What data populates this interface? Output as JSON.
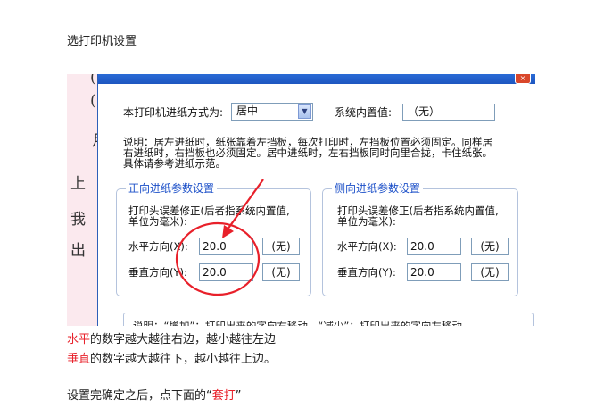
{
  "doc": {
    "heading": "选打印机设置",
    "line1": {
      "hl": "水平",
      "rest": "的数字越大越往右边，越小越往左边"
    },
    "line2": {
      "hl": "垂直",
      "rest": "的数字越大越往下，越小越往上边。"
    },
    "line3": {
      "pre": "设置完确定之后，点下面的“",
      "hl": "套打",
      "post": "”"
    }
  },
  "background_chars": [
    "(",
    "(",
    "月",
    "上",
    "我",
    "出"
  ],
  "dialog": {
    "close_glyph": "×",
    "feed_label": "本打印机进纸方式为:",
    "feed_value": "居中",
    "feed_arrow": "▼",
    "sys_label": "系统内置值:",
    "sys_value": "（无）",
    "note_lines": [
      "说明：居左进纸时，纸张靠着左挡板，每次打印时，左挡板位置必须固定。同样居",
      "右进纸时，右挡板也必须固定。居中进纸时，左右挡板同时向里合拢，卡住纸张。",
      "具体请参考进纸示范。"
    ],
    "front_group": {
      "title": "正向进纸参数设置",
      "desc_line1": "打印头误差修正(后者指系统内置值,",
      "desc_line2": "单位为毫米):",
      "h_label": "水平方向(X):",
      "h_value": "20.0",
      "h_sys": "(无)",
      "v_label": "垂直方向(Y):",
      "v_value": "20.0",
      "v_sys": "(无)"
    },
    "side_group": {
      "title": "侧向进纸参数设置",
      "desc_line1": "打印头误差修正(后者指系统内置值,",
      "desc_line2": "单位为毫米):",
      "h_label": "水平方向(X):",
      "h_value": "20.0",
      "h_sys": "(无)",
      "v_label": "垂直方向(Y):",
      "v_value": "20.0",
      "v_sys": "(无)"
    },
    "bottom_text": "说明：“增加”：打印出来的字向右移动。“减少”：打印出来的字向左移动"
  },
  "colors": {
    "highlight": "#e8202a",
    "annotation": "#e8202a",
    "group_title": "#1b4fc8"
  }
}
